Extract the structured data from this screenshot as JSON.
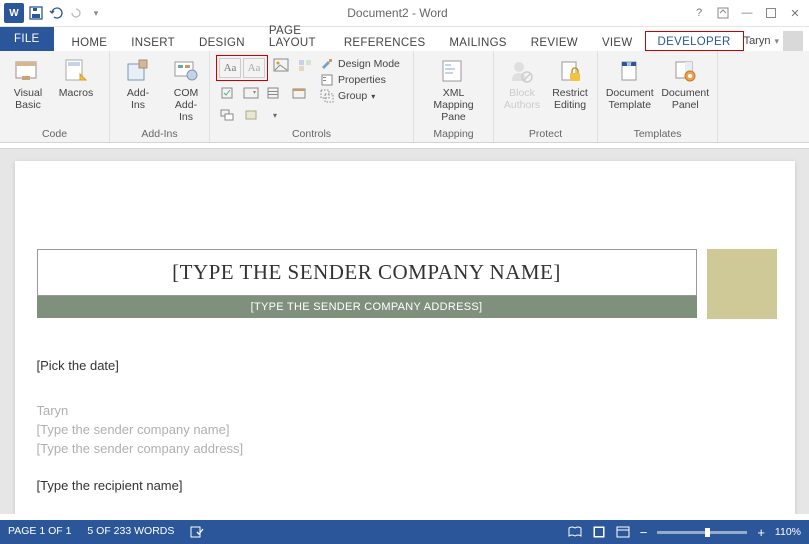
{
  "titlebar": {
    "title": "Document2 - Word"
  },
  "tabs": {
    "file": "FILE",
    "list": [
      "HOME",
      "INSERT",
      "DESIGN",
      "PAGE LAYOUT",
      "REFERENCES",
      "MAILINGS",
      "REVIEW",
      "VIEW"
    ],
    "developer": "DEVELOPER",
    "user": "Taryn"
  },
  "ribbon": {
    "code": {
      "visual_basic": "Visual\nBasic",
      "macros": "Macros",
      "label": "Code"
    },
    "addins": {
      "addins": "Add-Ins",
      "com": "COM\nAdd-Ins",
      "label": "Add-Ins"
    },
    "controls": {
      "design_mode": "Design Mode",
      "properties": "Properties",
      "group": "Group",
      "label": "Controls"
    },
    "mapping": {
      "xml": "XML Mapping\nPane",
      "label": "Mapping"
    },
    "protect": {
      "block": "Block\nAuthors",
      "restrict": "Restrict\nEditing",
      "label": "Protect"
    },
    "templates": {
      "template": "Document\nTemplate",
      "panel": "Document\nPanel",
      "label": "Templates"
    }
  },
  "doc": {
    "company_name": "[TYPE THE SENDER COMPANY NAME]",
    "company_addr": "[TYPE THE SENDER COMPANY ADDRESS]",
    "pick_date": "[Pick the date]",
    "sender_name": "Taryn",
    "sender_company": "[Type the sender company name]",
    "sender_address": "[Type the sender company address]",
    "recipient_name": "[Type the recipient name]"
  },
  "status": {
    "page": "PAGE 1 OF 1",
    "words": "5 OF 233 WORDS",
    "zoom": "110%"
  }
}
